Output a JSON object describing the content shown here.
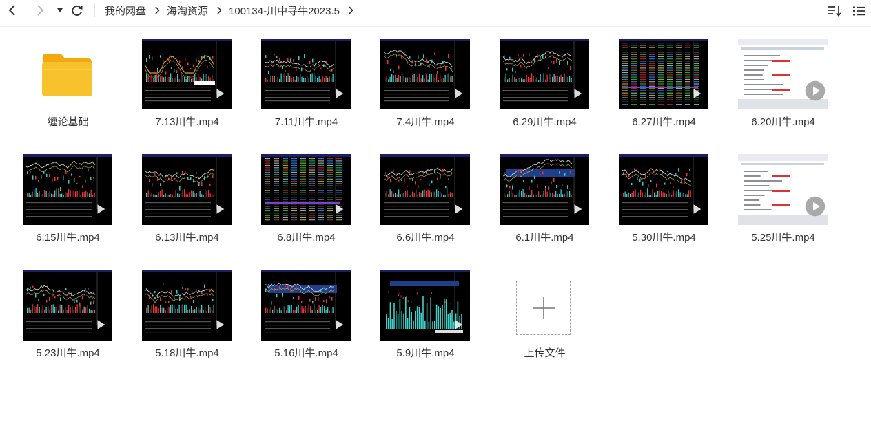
{
  "toolbar": {
    "back_icon": "chevron-left-icon",
    "forward_icon": "chevron-right-icon",
    "dropdown_icon": "caret-down-icon",
    "refresh_icon": "refresh-icon",
    "sort_icon": "sort-icon",
    "view_icon": "list-view-icon"
  },
  "breadcrumb": {
    "items": [
      "我的网盘",
      "海淘资源",
      "100134-川中寻牛2023.5"
    ]
  },
  "folder": {
    "name": "缠论基础"
  },
  "files": [
    {
      "name": "7.13川牛.mp4",
      "style": "a"
    },
    {
      "name": "7.11川牛.mp4",
      "style": "b"
    },
    {
      "name": "7.4川牛.mp4",
      "style": "b"
    },
    {
      "name": "6.29川牛.mp4",
      "style": "c"
    },
    {
      "name": "6.27川牛.mp4",
      "style": "d"
    },
    {
      "name": "6.20川牛.mp4",
      "style": "w"
    },
    {
      "name": "6.15川牛.mp4",
      "style": "b"
    },
    {
      "name": "6.13川牛.mp4",
      "style": "b"
    },
    {
      "name": "6.8川牛.mp4",
      "style": "d"
    },
    {
      "name": "6.6川牛.mp4",
      "style": "b"
    },
    {
      "name": "6.1川牛.mp4",
      "style": "e"
    },
    {
      "name": "5.30川牛.mp4",
      "style": "b"
    },
    {
      "name": "5.25川牛.mp4",
      "style": "w"
    },
    {
      "name": "5.23川牛.mp4",
      "style": "b"
    },
    {
      "name": "5.18川牛.mp4",
      "style": "b"
    },
    {
      "name": "5.16川牛.mp4",
      "style": "e"
    },
    {
      "name": "5.9川牛.mp4",
      "style": "f"
    }
  ],
  "upload": {
    "label": "上传文件",
    "icon": "plus-icon"
  },
  "colors": {
    "folder": "#f7c22c",
    "thumb_bg": "#000000",
    "upload_border": "#9aa0a6"
  }
}
